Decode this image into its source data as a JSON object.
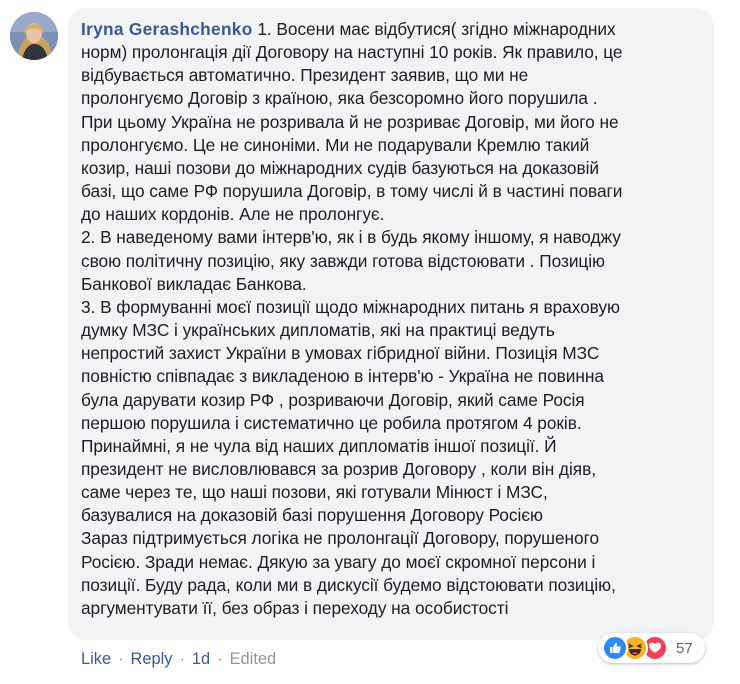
{
  "comment": {
    "author": "Iryna Gerashchenko",
    "body": "1. Восени має відбутися( згідно міжнародних\nнорм) пролонгація дії Договору на наступні 10 років. Як правило, це\nвідбувається автоматично. Президент заявив, що ми не\nпролонгуємо Договір з країною, яка безсоромно його порушила .\nПри цьому Україна не розривала й не розриває Договір, ми його не\nпролонгуємо. Це не синоніми. Ми не подарували Кремлю такий\nкозир, наші позови до міжнародних судів базуються на доказовій\nбазі, що саме РФ порушила Договір, в тому числі й в частині поваги\nдо наших кордонів. Але не пролонгує.\n2. В наведеному вами інтерв'ю, як і в будь якому іншому, я наводжу\nсвою політичну позицію, яку завжди готова відстоювати . Позицію\nБанкової викладає Банкова.\n3. В формуванні моєї позиції щодо міжнародних питань я враховую\nдумку МЗС і українських дипломатів, які на практиці ведуть\nнепростий захист України в умовах гібридної війни. Позиція МЗС\nповністю співпадає з викладеною в інтерв'ю - Україна не повинна\nбула дарувати козир РФ , розриваючи Договір, який саме Росія\nпершою порушила і систематично це робила протягом 4 років.\nПринаймні, я не чула від наших дипломатів іншої позиції. Й\nпрезидент не висловлювався за розрив Договору , коли він діяв,\nсаме через те, що наші позови, які готували Мінюст і МЗС,\nбазувалися на доказовій базі порушення Договору Росією\nЗараз підтримується логіка не пролонгації Договору, порушеного\nРосією. Зради немає. Дякую за увагу до моєї скромної персони і\nпозиції. Буду рада, коли ми в дискусії будемо відстоювати позицію,\nаргументувати її, без образ і переходу на особистості"
  },
  "actions": {
    "like_label": "Like",
    "separator": "·",
    "reply_label": "Reply",
    "timestamp": "1d",
    "edited_label": "Edited"
  },
  "reactions": {
    "icons": [
      "like-icon",
      "haha-icon",
      "love-icon"
    ],
    "count": "57"
  },
  "colors": {
    "bubble_bg": "#f2f3f5",
    "author": "#385898",
    "link": "#385898",
    "meta": "#90949c",
    "like_blue": "#2d88ff",
    "haha_yellow": "#f7b125",
    "love_red": "#f33e58"
  }
}
